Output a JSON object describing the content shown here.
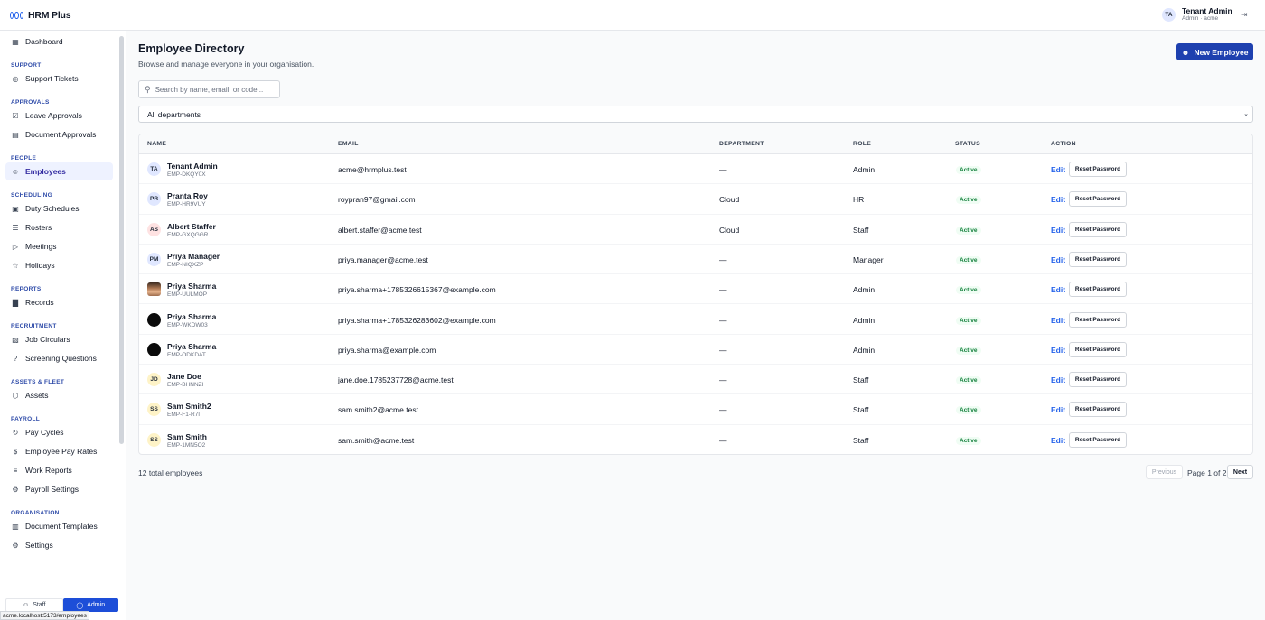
{
  "app": {
    "brand": "HRM Plus",
    "status_url": "acme.localhost:5173/employees"
  },
  "user": {
    "initials": "TA",
    "name": "Tenant Admin",
    "subtitle": "Admin · acme"
  },
  "sidebar": {
    "sections": [
      {
        "title": "",
        "items": [
          {
            "label": "Dashboard",
            "icon": "grid-icon"
          }
        ]
      },
      {
        "title": "SUPPORT",
        "items": [
          {
            "label": "Support Tickets",
            "icon": "lifebuoy-icon"
          }
        ]
      },
      {
        "title": "APPROVALS",
        "items": [
          {
            "label": "Leave Approvals",
            "icon": "clipboard-check-icon"
          },
          {
            "label": "Document Approvals",
            "icon": "document-icon"
          }
        ]
      },
      {
        "title": "PEOPLE",
        "items": [
          {
            "label": "Employees",
            "icon": "users-icon",
            "active": true
          }
        ]
      },
      {
        "title": "SCHEDULING",
        "items": [
          {
            "label": "Duty Schedules",
            "icon": "calendar-icon"
          },
          {
            "label": "Rosters",
            "icon": "list-icon"
          },
          {
            "label": "Meetings",
            "icon": "video-icon"
          },
          {
            "label": "Holidays",
            "icon": "calendar-star-icon"
          }
        ]
      },
      {
        "title": "REPORTS",
        "items": [
          {
            "label": "Records",
            "icon": "bar-chart-icon"
          }
        ]
      },
      {
        "title": "RECRUITMENT",
        "items": [
          {
            "label": "Job Circulars",
            "icon": "briefcase-icon"
          },
          {
            "label": "Screening Questions",
            "icon": "help-circle-icon"
          }
        ]
      },
      {
        "title": "ASSETS & FLEET",
        "items": [
          {
            "label": "Assets",
            "icon": "package-icon"
          }
        ]
      },
      {
        "title": "PAYROLL",
        "items": [
          {
            "label": "Pay Cycles",
            "icon": "refresh-icon"
          },
          {
            "label": "Employee Pay Rates",
            "icon": "dollar-icon"
          },
          {
            "label": "Work Reports",
            "icon": "file-text-icon"
          },
          {
            "label": "Payroll Settings",
            "icon": "gear-icon"
          }
        ]
      },
      {
        "title": "ORGANISATION",
        "items": [
          {
            "label": "Document Templates",
            "icon": "file-template-icon"
          },
          {
            "label": "Settings",
            "icon": "gear-icon"
          }
        ]
      }
    ],
    "role_switch": {
      "staff": "Staff",
      "admin": "Admin"
    }
  },
  "page": {
    "title": "Employee Directory",
    "subtitle": "Browse and manage everyone in your organisation.",
    "new_button": "New Employee",
    "search_placeholder": "Search by name, email, or code...",
    "department_filter": "All departments"
  },
  "table": {
    "headers": {
      "name": "NAME",
      "email": "EMAIL",
      "department": "DEPARTMENT",
      "role": "ROLE",
      "status": "STATUS",
      "action": "ACTION"
    },
    "edit_label": "Edit",
    "reset_label": "Reset Password",
    "rows": [
      {
        "initials": "TA",
        "avatar": "initials",
        "name": "Tenant Admin",
        "code": "EMP-DKQY0X",
        "email": "acme@hrmplus.test",
        "department": "—",
        "role": "Admin",
        "status": "Active"
      },
      {
        "initials": "PR",
        "avatar": "initials",
        "name": "Pranta Roy",
        "code": "EMP-HR9VUY",
        "email": "roypran97@gmail.com",
        "department": "Cloud",
        "role": "HR",
        "status": "Active"
      },
      {
        "initials": "AS",
        "avatar": "initials-pink",
        "name": "Albert Staffer",
        "code": "EMP-GXQGGR",
        "email": "albert.staffer@acme.test",
        "department": "Cloud",
        "role": "Staff",
        "status": "Active"
      },
      {
        "initials": "PM",
        "avatar": "initials",
        "name": "Priya Manager",
        "code": "EMP-NIQXZP",
        "email": "priya.manager@acme.test",
        "department": "—",
        "role": "Manager",
        "status": "Active"
      },
      {
        "initials": "",
        "avatar": "photo",
        "name": "Priya Sharma",
        "code": "EMP-UULMOP",
        "email": "priya.sharma+1785326615367@example.com",
        "department": "—",
        "role": "Admin",
        "status": "Active"
      },
      {
        "initials": "",
        "avatar": "dark",
        "name": "Priya Sharma",
        "code": "EMP-WKDW03",
        "email": "priya.sharma+1785326283602@example.com",
        "department": "—",
        "role": "Admin",
        "status": "Active"
      },
      {
        "initials": "",
        "avatar": "dark",
        "name": "Priya Sharma",
        "code": "EMP-ODKDAT",
        "email": "priya.sharma@example.com",
        "department": "—",
        "role": "Admin",
        "status": "Active"
      },
      {
        "initials": "JD",
        "avatar": "initials-yellow",
        "name": "Jane Doe",
        "code": "EMP-BHNNZI",
        "email": "jane.doe.1785237728@acme.test",
        "department": "—",
        "role": "Staff",
        "status": "Active"
      },
      {
        "initials": "SS",
        "avatar": "initials-yellow",
        "name": "Sam Smith2",
        "code": "EMP-F1-R7I",
        "email": "sam.smith2@acme.test",
        "department": "—",
        "role": "Staff",
        "status": "Active"
      },
      {
        "initials": "SS",
        "avatar": "initials-yellow",
        "name": "Sam Smith",
        "code": "EMP-1MN5O2",
        "email": "sam.smith@acme.test",
        "department": "—",
        "role": "Staff",
        "status": "Active"
      }
    ]
  },
  "pagination": {
    "total": "12 total employees",
    "previous": "Previous",
    "page": "Page 1 of 2",
    "next": "Next"
  }
}
